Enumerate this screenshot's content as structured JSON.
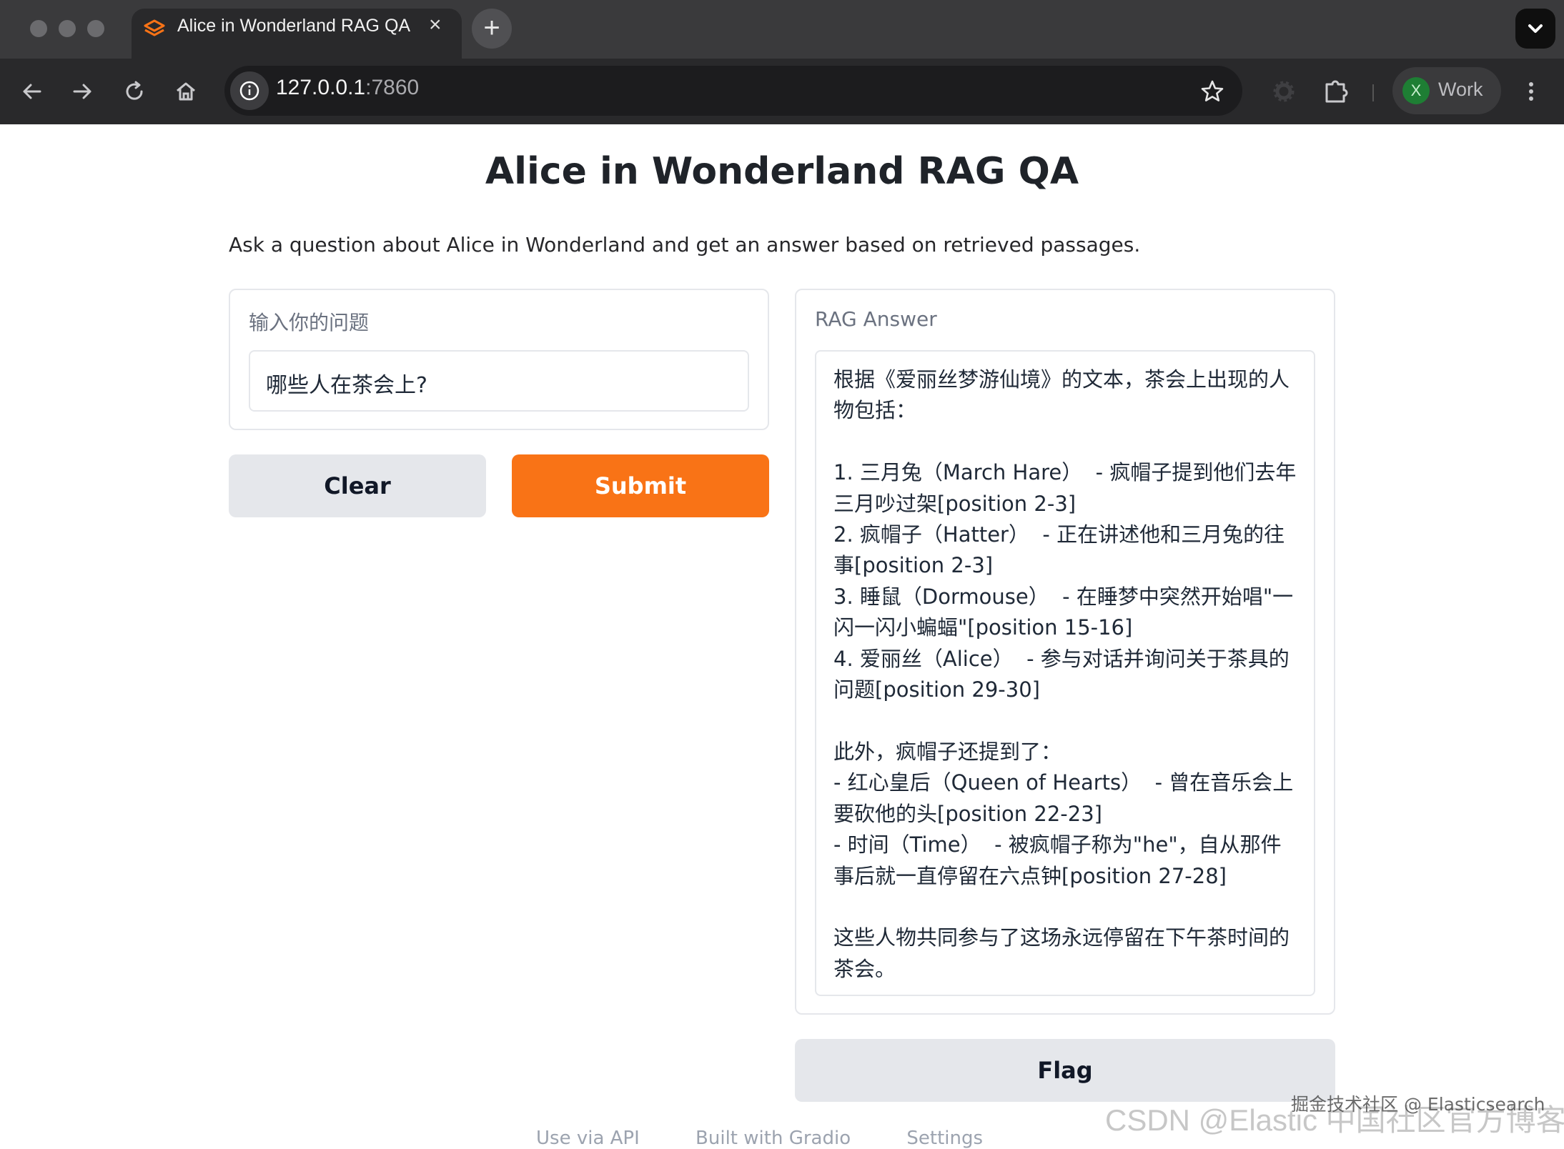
{
  "browser": {
    "tab_title": "Alice in Wonderland RAG QA",
    "close_glyph": "×",
    "new_tab_glyph": "+",
    "url_host": "127.0.0.1",
    "url_port": ":7860",
    "profile_initial": "X",
    "profile_name": "Work",
    "profile_color": "#1e7e34"
  },
  "page": {
    "title": "Alice in Wonderland RAG QA",
    "description": "Ask a question about Alice in Wonderland and get an answer based on retrieved passages."
  },
  "input_panel": {
    "label": "输入你的问题",
    "value": "哪些人在茶会上?"
  },
  "buttons": {
    "clear": "Clear",
    "submit": "Submit",
    "flag": "Flag",
    "submit_color": "#f97316"
  },
  "output_panel": {
    "label": "RAG Answer",
    "answer": "根据《爱丽丝梦游仙境》的文本，茶会上出现的人物包括：\n\n1. 三月兔（March Hare）  - 疯帽子提到他们去年三月吵过架[position 2-3]\n2. 疯帽子（Hatter）  - 正在讲述他和三月兔的往事[position 2-3]\n3. 睡鼠（Dormouse）  - 在睡梦中突然开始唱\"一闪一闪小蝙蝠\"[position 15-16]\n4. 爱丽丝（Alice）  - 参与对话并询问关于茶具的问题[position 29-30]\n\n此外，疯帽子还提到了：\n- 红心皇后（Queen of Hearts）  - 曾在音乐会上要砍他的头[position 22-23]\n- 时间（Time）  - 被疯帽子称为\"he\"，自从那件事后就一直停留在六点钟[position 27-28]\n\n这些人物共同参与了这场永远停留在下午茶时间的茶会。"
  },
  "footer": {
    "api": "Use via API",
    "built": "Built with Gradio",
    "settings": "Settings"
  },
  "watermarks": {
    "juejin": "掘金技术社区 @ Elasticsearch",
    "csdn": "CSDN @Elastic 中国社区官方博客"
  }
}
